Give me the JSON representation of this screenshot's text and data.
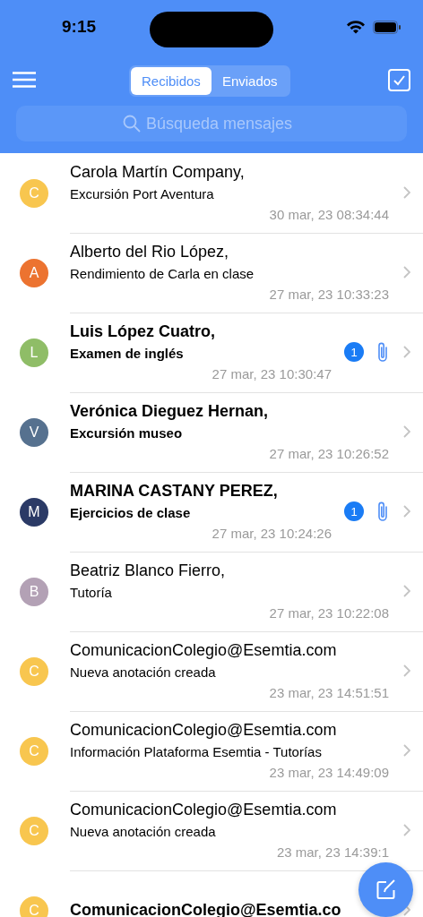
{
  "status_bar": {
    "time": "9:15"
  },
  "tabs": [
    {
      "label": "Recibidos",
      "selected": true
    },
    {
      "label": "Enviados",
      "selected": false
    }
  ],
  "search": {
    "placeholder": "Búsqueda mensajes"
  },
  "messages": [
    {
      "sender": "Carola Martín Company,",
      "subject": "Excursión Port Aventura",
      "date": "30 mar, 23 08:34:44",
      "initial": "C",
      "color": "#f8c64f",
      "unread": false,
      "attachment": false
    },
    {
      "sender": "Alberto del Rio López,",
      "subject": "Rendimiento de Carla en clase",
      "date": "27 mar, 23 10:33:23",
      "initial": "A",
      "color": "#ec7330",
      "unread": false,
      "attachment": false
    },
    {
      "sender": "Luis López Cuatro,",
      "subject": "Examen de inglés",
      "date": "27 mar, 23 10:30:47",
      "initial": "L",
      "color": "#8fbd67",
      "unread": true,
      "badge": "1",
      "attachment": true
    },
    {
      "sender": "Verónica Dieguez Hernan,",
      "subject": "Excursión museo",
      "date": "27 mar, 23 10:26:52",
      "initial": "V",
      "color": "#56718f",
      "unread": true,
      "attachment": false
    },
    {
      "sender": "MARINA CASTANY PEREZ,",
      "subject": "Ejercicios de clase",
      "date": "27 mar, 23 10:24:26",
      "initial": "M",
      "color": "#2b3a66",
      "unread": true,
      "badge": "1",
      "attachment": true
    },
    {
      "sender": "Beatriz Blanco Fierro,",
      "subject": "Tutoría",
      "date": "27 mar, 23 10:22:08",
      "initial": "B",
      "color": "#b3a1b5",
      "unread": false,
      "attachment": false
    },
    {
      "sender": "ComunicacionColegio@Esemtia.com",
      "subject": "Nueva anotación creada",
      "date": "23 mar, 23 14:51:51",
      "initial": "C",
      "color": "#f8c64f",
      "unread": false,
      "attachment": false
    },
    {
      "sender": "ComunicacionColegio@Esemtia.com",
      "subject": "Información Plataforma Esemtia - Tutorías",
      "date": "23 mar, 23 14:49:09",
      "initial": "C",
      "color": "#f8c64f",
      "unread": false,
      "attachment": false
    },
    {
      "sender": "ComunicacionColegio@Esemtia.com",
      "subject": "Nueva anotación creada",
      "date": "23 mar, 23 14:39:1",
      "initial": "C",
      "color": "#f8c64f",
      "unread": false,
      "attachment": false
    },
    {
      "sender": "ComunicacionColegio@Esemtia.co",
      "initial": "C",
      "color": "#f8c64f",
      "unread": true,
      "attachment": false
    }
  ]
}
